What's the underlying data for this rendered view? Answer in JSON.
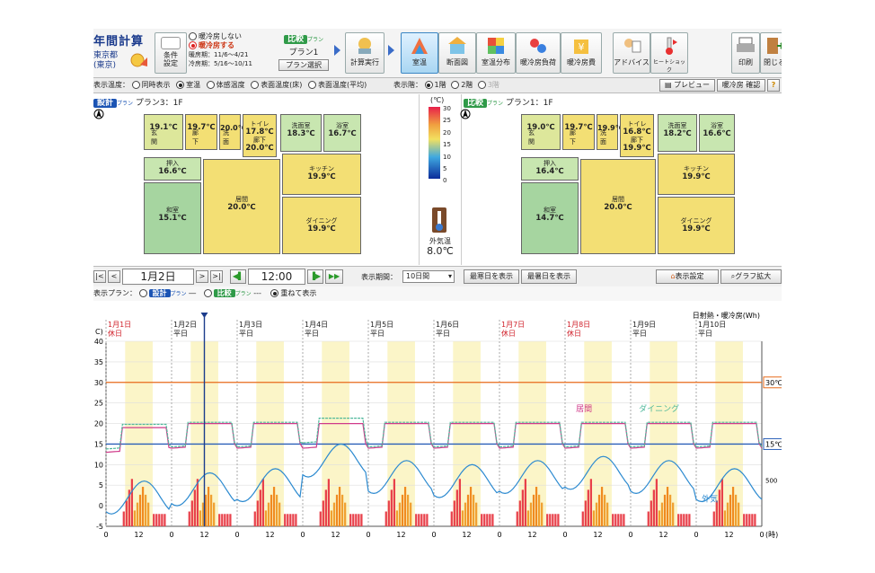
{
  "toolbar": {
    "title": "年間計算",
    "location_line1": "東京都",
    "location_line2": "(東京)",
    "condition_label": "条件\n設定",
    "hvac_off": "暖冷房しない",
    "hvac_on": "暖冷房する",
    "heating_period": "暖房期：11/6～4/21",
    "cooling_period": "冷房期：5/16～10/11",
    "compare_tag": "比較",
    "compare_plan_word": "プラン",
    "compare_plan_name": "プラン1",
    "plan_select": "プラン選択",
    "run": "計算実行",
    "views": [
      "室温",
      "断面図",
      "室温分布",
      "暖冷房負荷",
      "暖冷房費"
    ],
    "advice": "アドバイス",
    "heat_shock": "ヒートショック",
    "print": "印刷",
    "close": "閉じる"
  },
  "options": {
    "display_temp": "表示温度：",
    "modes": [
      "同時表示",
      "室温",
      "体感温度",
      "表面温度(床)",
      "表面温度(平均)"
    ],
    "selected_mode": 1,
    "floor_label": "表示階：",
    "floors": [
      "1階",
      "2階",
      "3階"
    ],
    "selected_floor": 0,
    "preview": "プレビュー",
    "hvac_confirm": "暖冷房 確認"
  },
  "plans": {
    "design": {
      "tag": "設計",
      "plan_word": "プラン",
      "name": "プラン3：1F",
      "rooms": {
        "genkan": {
          "name": "玄関",
          "temp": "19.1℃"
        },
        "rouka1": {
          "name": "廊下",
          "temp": "19.7℃"
        },
        "senmen_small": {
          "name": "洗面",
          "temp": "20.0℃"
        },
        "toilet": {
          "name": "トイレ",
          "temp": "17.8℃"
        },
        "rouka2": {
          "name": "廊下",
          "temp": "20.0℃"
        },
        "senmenjo": {
          "name": "洗面室",
          "temp": "18.3℃"
        },
        "yokushitsu": {
          "name": "浴室",
          "temp": "16.7℃"
        },
        "oshiire": {
          "name": "押入",
          "temp": "16.6℃"
        },
        "washitsu": {
          "name": "和室",
          "temp": "15.1℃"
        },
        "ima": {
          "name": "居間",
          "temp": "20.0℃"
        },
        "kitchen": {
          "name": "キッチン",
          "temp": "19.9℃"
        },
        "dining": {
          "name": "ダイニング",
          "temp": "19.9℃"
        }
      }
    },
    "compare": {
      "tag": "比較",
      "plan_word": "プラン",
      "name": "プラン1：1F",
      "rooms": {
        "genkan": {
          "name": "玄関",
          "temp": "19.0℃"
        },
        "rouka1": {
          "name": "廊下",
          "temp": "19.7℃"
        },
        "senmen_small": {
          "name": "洗面",
          "temp": "19.9℃"
        },
        "toilet": {
          "name": "トイレ",
          "temp": "16.8℃"
        },
        "rouka2": {
          "name": "廊下",
          "temp": "19.9℃"
        },
        "senmenjo": {
          "name": "洗面室",
          "temp": "18.2℃"
        },
        "yokushitsu": {
          "name": "浴室",
          "temp": "16.6℃"
        },
        "oshiire": {
          "name": "押入",
          "temp": "16.4℃"
        },
        "washitsu": {
          "name": "和室",
          "temp": "14.7℃"
        },
        "ima": {
          "name": "居間",
          "temp": "20.0℃"
        },
        "kitchen": {
          "name": "キッチン",
          "temp": "19.9℃"
        },
        "dining": {
          "name": "ダイニング",
          "temp": "19.9℃"
        }
      }
    }
  },
  "legend": {
    "unit": "(℃)",
    "ticks": [
      "30",
      "25",
      "20",
      "15",
      "10",
      "5",
      "0"
    ],
    "outside_label": "外気温",
    "outside_temp": "8.0℃"
  },
  "controls": {
    "date": "1月2日",
    "time": "12:00",
    "period_label": "表示期間：",
    "period_value": "10日間",
    "coldest": "最寒日を表示",
    "hottest": "最暑日を表示",
    "display_settings": "表示設定",
    "graph_zoom": "グラフ拡大",
    "display_plan_label": "表示プラン：",
    "design_tag": "設計",
    "compare_tag": "比較",
    "plan_word": "プラン",
    "overlay": "重ねて表示"
  },
  "chart_data": {
    "type": "line",
    "title": "",
    "right_label": "日射熱・暖冷房(Wh)",
    "ylim": [
      -5,
      40
    ],
    "yticks": [
      "40",
      "35",
      "30",
      "25",
      "20",
      "15",
      "10",
      "5",
      "0",
      "-5"
    ],
    "right_tick": "500",
    "ylabel_frag": "C)",
    "days": [
      {
        "date": "1月1日",
        "type": "休日",
        "holiday": true
      },
      {
        "date": "1月2日",
        "type": "平日",
        "holiday": false
      },
      {
        "date": "1月3日",
        "type": "平日",
        "holiday": false
      },
      {
        "date": "1月4日",
        "type": "平日",
        "holiday": false
      },
      {
        "date": "1月5日",
        "type": "平日",
        "holiday": false
      },
      {
        "date": "1月6日",
        "type": "平日",
        "holiday": false
      },
      {
        "date": "1月7日",
        "type": "休日",
        "holiday": true
      },
      {
        "date": "1月8日",
        "type": "休日",
        "holiday": true
      },
      {
        "date": "1月9日",
        "type": "平日",
        "holiday": false
      },
      {
        "date": "1月10日",
        "type": "平日",
        "holiday": false
      }
    ],
    "xtick_labels": [
      "0",
      "12",
      "0",
      "12",
      "0",
      "12",
      "0",
      "12",
      "0",
      "12",
      "0",
      "12",
      "0",
      "12",
      "0",
      "12",
      "0",
      "12",
      "0",
      "12",
      "0"
    ],
    "x_unit": "(時)",
    "reference_lines": [
      {
        "label": "30℃",
        "value": 30,
        "color": "#e86a1a"
      },
      {
        "label": "15℃",
        "value": 15,
        "color": "#2a5fb8"
      }
    ],
    "series": [
      {
        "name": "居間",
        "color": "#d03a8a",
        "values_per_day": [
          19,
          20,
          20,
          20,
          20,
          20,
          20,
          20,
          20,
          20
        ]
      },
      {
        "name": "ダイニング",
        "color": "#4fb89a",
        "values_per_day": [
          19.5,
          20,
          20,
          21,
          20,
          20,
          20,
          20,
          20,
          20
        ]
      },
      {
        "name": "外気",
        "color": "#2c8ad0",
        "values_per_day": [
          5,
          7,
          8,
          14,
          10,
          9,
          10,
          11,
          10,
          8
        ]
      }
    ]
  }
}
